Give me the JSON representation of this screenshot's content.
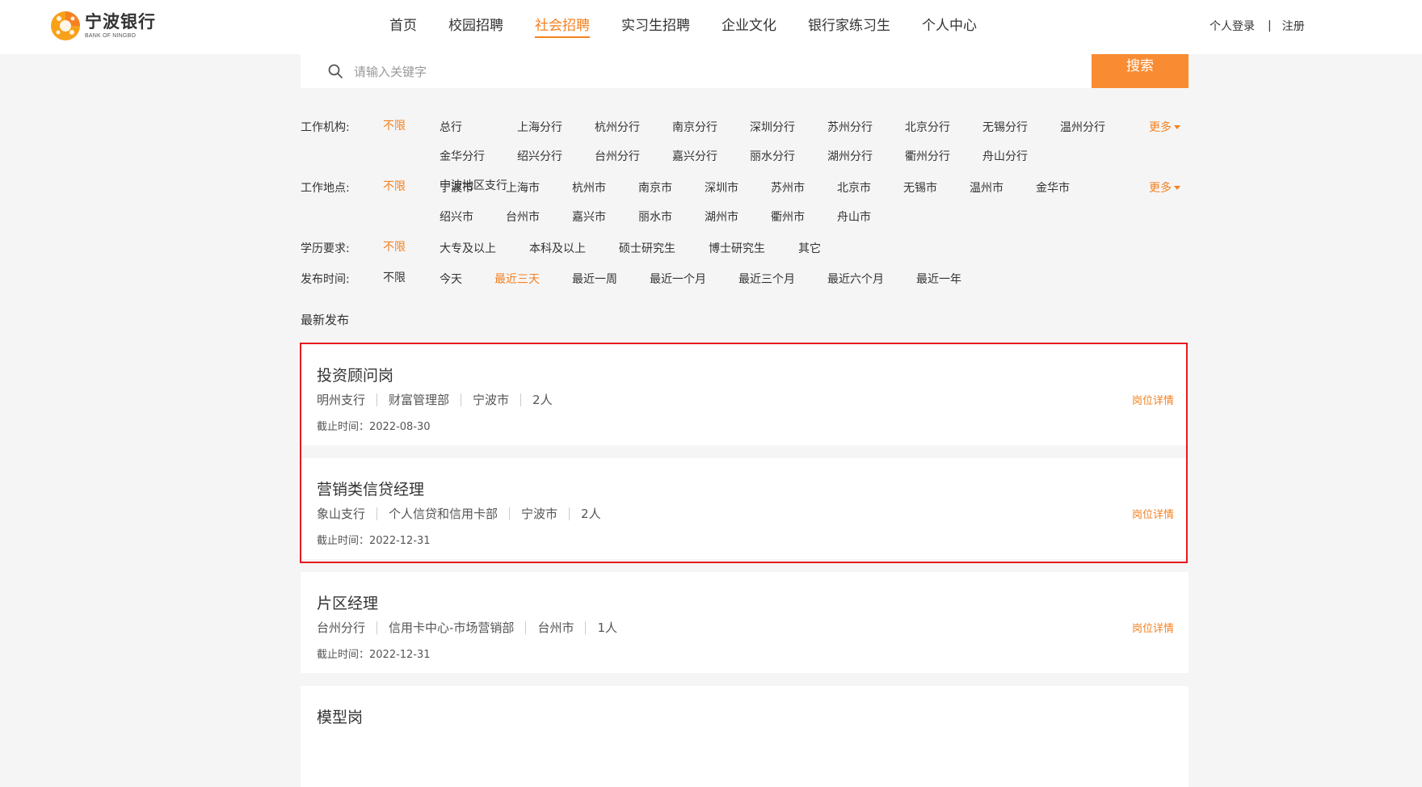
{
  "header": {
    "logo_cn": "宁波银行",
    "logo_en": "BANK OF NINGBO",
    "nav": [
      {
        "label": "首页",
        "active": false
      },
      {
        "label": "校园招聘",
        "active": false
      },
      {
        "label": "社会招聘",
        "active": true
      },
      {
        "label": "实习生招聘",
        "active": false
      },
      {
        "label": "企业文化",
        "active": false
      },
      {
        "label": "银行家练习生",
        "active": false
      },
      {
        "label": "个人中心",
        "active": false
      }
    ],
    "login": "个人登录",
    "separator": "|",
    "register": "注册"
  },
  "search": {
    "placeholder": "请输入关键字",
    "button": "搜索"
  },
  "filters": {
    "org": {
      "label": "工作机构:",
      "any": "不限",
      "options": [
        "总行",
        "上海分行",
        "杭州分行",
        "南京分行",
        "深圳分行",
        "苏州分行",
        "北京分行",
        "无锡分行",
        "温州分行",
        "金华分行",
        "绍兴分行",
        "台州分行",
        "嘉兴分行",
        "丽水分行",
        "湖州分行",
        "衢州分行",
        "舟山分行",
        "宁波地区支行"
      ],
      "more": "更多"
    },
    "location": {
      "label": "工作地点:",
      "any": "不限",
      "options": [
        "宁波市",
        "上海市",
        "杭州市",
        "南京市",
        "深圳市",
        "苏州市",
        "北京市",
        "无锡市",
        "温州市",
        "金华市",
        "绍兴市",
        "台州市",
        "嘉兴市",
        "丽水市",
        "湖州市",
        "衢州市",
        "舟山市"
      ],
      "more": "更多"
    },
    "education": {
      "label": "学历要求:",
      "any": "不限",
      "options": [
        "大专及以上",
        "本科及以上",
        "硕士研究生",
        "博士研究生",
        "其它"
      ]
    },
    "time": {
      "label": "发布时间:",
      "any": "不限",
      "options": [
        "今天",
        "最近三天",
        "最近一周",
        "最近一个月",
        "最近三个月",
        "最近六个月",
        "最近一年"
      ],
      "selected": "最近三天"
    }
  },
  "latest_label": "最新发布",
  "detail_label": "岗位详情",
  "jobs": [
    {
      "title": "投资顾问岗",
      "branch": "明州支行",
      "dept": "财富管理部",
      "city": "宁波市",
      "count": "2人",
      "deadline": "截止时间：2022-08-30"
    },
    {
      "title": "营销类信贷经理",
      "branch": "象山支行",
      "dept": "个人信贷和信用卡部",
      "city": "宁波市",
      "count": "2人",
      "deadline": "截止时间：2022-12-31"
    },
    {
      "title": "片区经理",
      "branch": "台州分行",
      "dept": "信用卡中心-市场营销部",
      "city": "台州市",
      "count": "1人",
      "deadline": "截止时间：2022-12-31"
    },
    {
      "title": "模型岗"
    }
  ],
  "colors": {
    "accent": "#f58120",
    "search_button": "#f98c33",
    "highlight_border": "#e8191f",
    "page_bg": "#f5f5f5"
  }
}
